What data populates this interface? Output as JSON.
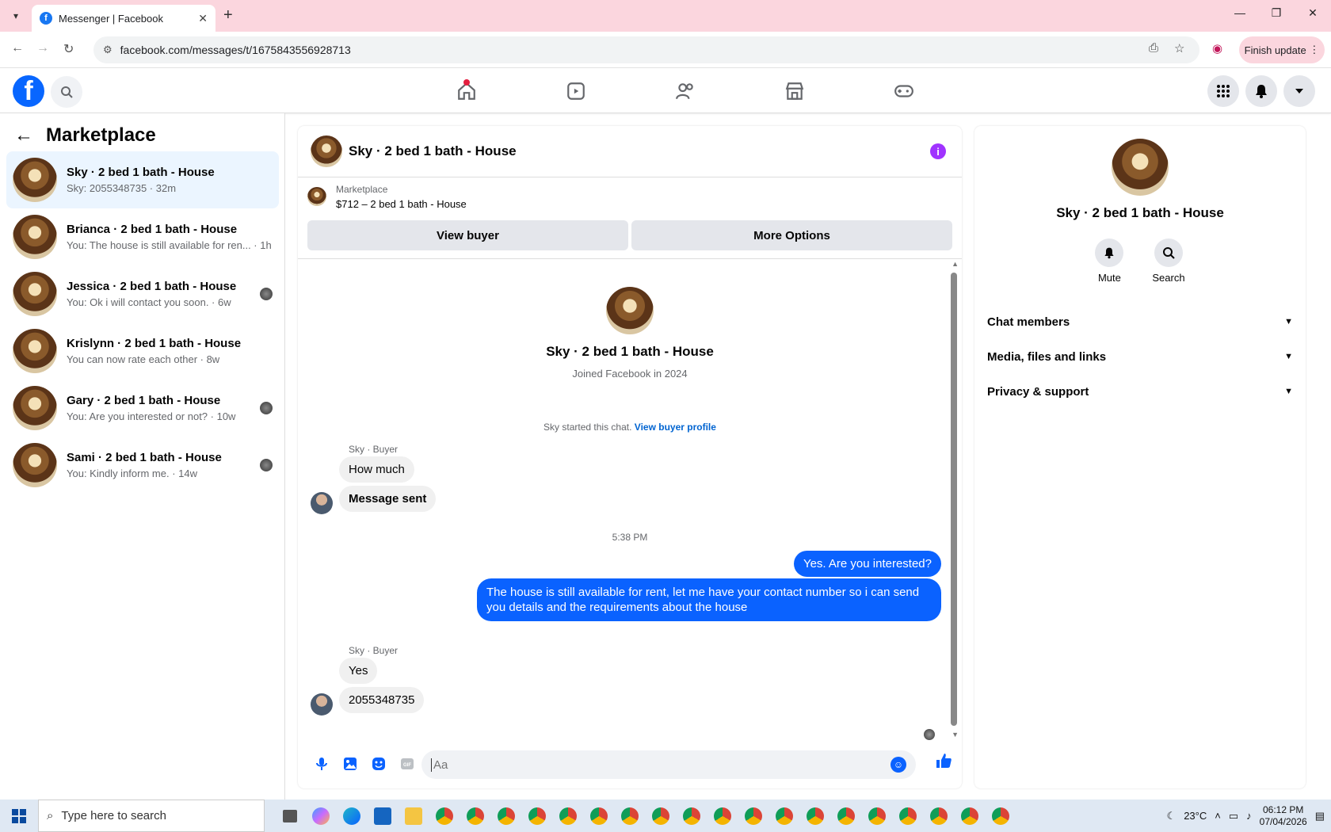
{
  "browser": {
    "tab_title": "Messenger | Facebook",
    "url": "facebook.com/messages/t/1675843556928713",
    "finish_update": "Finish update"
  },
  "left": {
    "title": "Marketplace",
    "conversations": [
      {
        "name": "Sky · 2 bed 1 bath - House",
        "preview": "Sky: 2055348735 · 32m"
      },
      {
        "name": "Brianca · 2 bed 1 bath - House",
        "preview": "You: The house is still available for ren... · 1h"
      },
      {
        "name": "Jessica · 2 bed 1 bath - House",
        "preview": "You: Ok i will contact you soon. · 6w"
      },
      {
        "name": "Krislynn · 2 bed 1 bath - House",
        "preview": "You can now rate each other · 8w"
      },
      {
        "name": "Gary · 2 bed 1 bath - House",
        "preview": "You: Are you interested or not? · 10w"
      },
      {
        "name": "Sami · 2 bed 1 bath - House",
        "preview": "You: Kindly inform me. · 14w"
      }
    ]
  },
  "chat": {
    "title": "Sky · 2 bed 1 bath - House",
    "listing_label": "Marketplace",
    "listing": "$712 – 2 bed 1 bath - House",
    "view_buyer": "View buyer",
    "more_options": "More Options",
    "intro_name": "Sky · 2 bed 1 bath - House",
    "intro_joined": "Joined Facebook in 2024",
    "started_text": "Sky started this chat.",
    "view_buyer_profile": "View buyer profile",
    "sender1": "Sky · Buyer",
    "msg1": "How much",
    "msg2": "Message sent",
    "time": "5:38 PM",
    "my_msg1": "Yes. Are you interested?",
    "my_msg2": "The house is still available for rent, let me have your contact number so i can send you details and the requirements about the house",
    "sender2": "Sky · Buyer",
    "msg3": "Yes",
    "msg4": "2055348735",
    "input_placeholder": "Aa"
  },
  "right": {
    "name": "Sky · 2 bed 1 bath - House",
    "mute": "Mute",
    "search": "Search",
    "sections": [
      "Chat members",
      "Media, files and links",
      "Privacy & support"
    ]
  },
  "taskbar": {
    "search_placeholder": "Type here to search",
    "temp": "23°C",
    "time": "06:12 PM",
    "date": "07/04/2026"
  }
}
